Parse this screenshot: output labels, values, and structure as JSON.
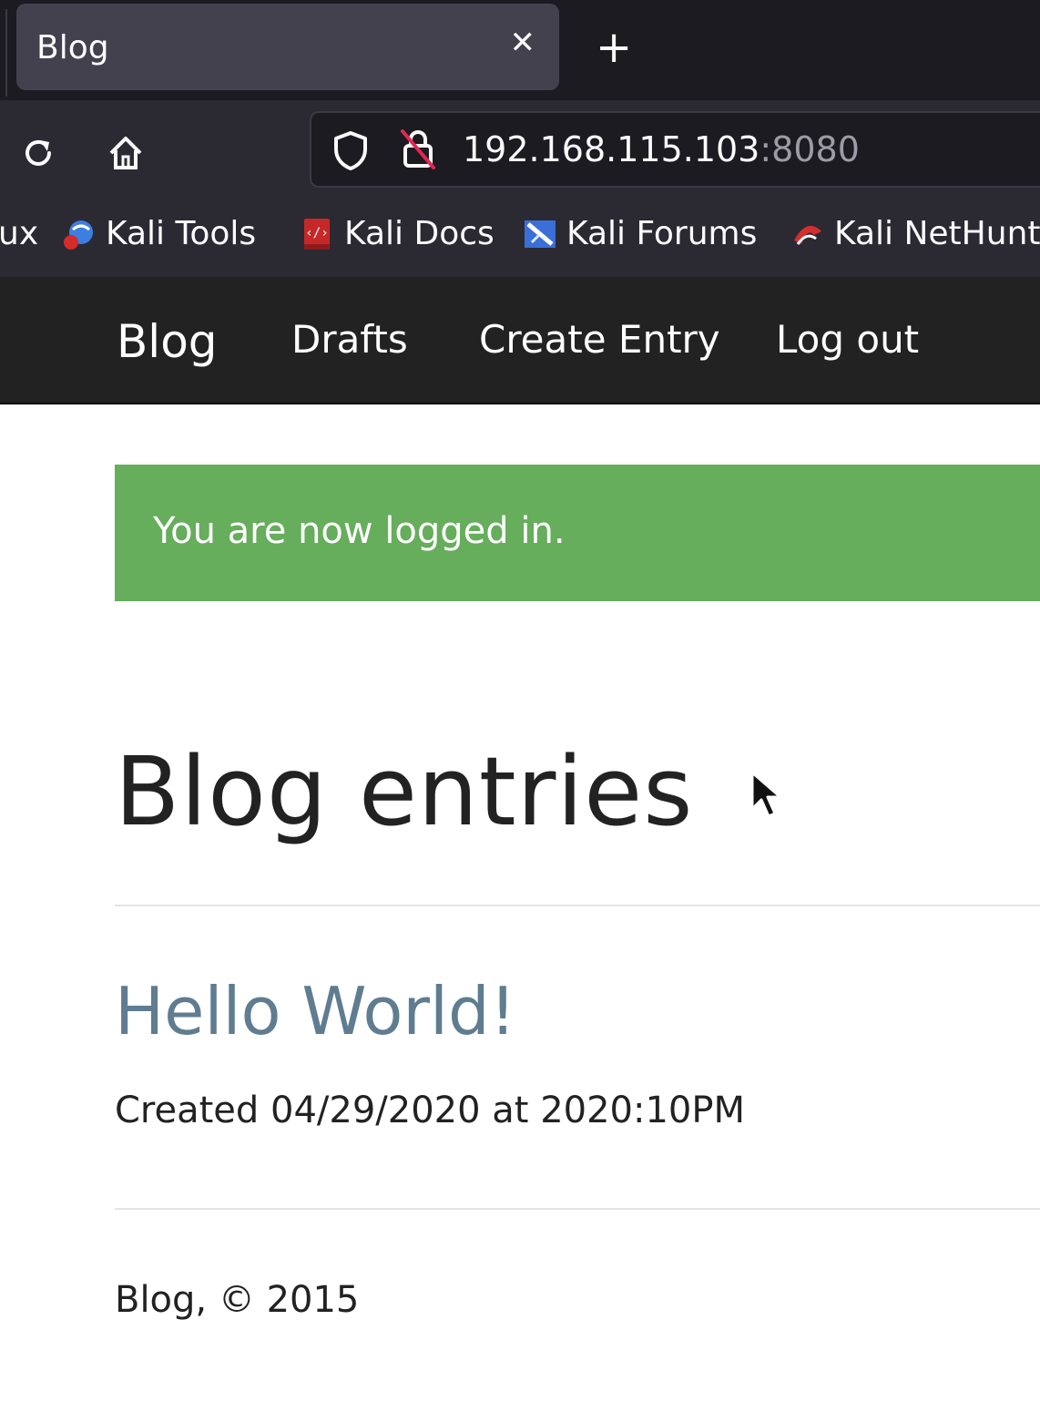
{
  "browser": {
    "tab": {
      "title": "Blog",
      "close_icon": "close-icon"
    },
    "new_tab_icon": "plus-icon",
    "toolbar": {
      "reload_icon": "reload-icon",
      "home_icon": "home-icon",
      "url_host": "192.168.115.103",
      "url_port": ":8080",
      "shield_icon": "shield-icon",
      "insecure_icon": "insecure-lock-icon"
    },
    "bookmarks": [
      {
        "label": "ux",
        "icon": ""
      },
      {
        "label": "Kali Tools",
        "icon": "kali-tools-icon"
      },
      {
        "label": "Kali Docs",
        "icon": "kali-docs-icon"
      },
      {
        "label": "Kali Forums",
        "icon": "kali-forums-icon"
      },
      {
        "label": "Kali NetHunt",
        "icon": "kali-nethunter-icon"
      }
    ]
  },
  "site": {
    "brand": "Blog",
    "nav": [
      "Drafts",
      "Create Entry",
      "Log out"
    ],
    "alert": {
      "text": "You are now logged in.",
      "color": "#66ad5c"
    },
    "heading": "Blog entries",
    "entries": [
      {
        "title": "Hello World!",
        "meta": "Created 04/29/2020 at 2020:10PM"
      }
    ],
    "footer": "Blog, © 2015"
  }
}
